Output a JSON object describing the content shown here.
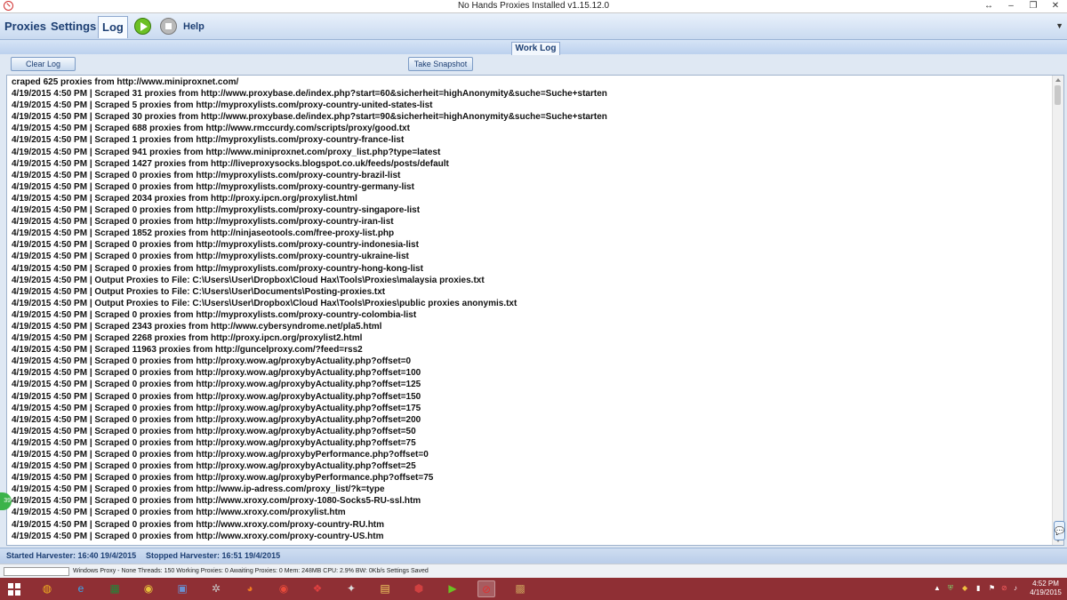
{
  "window": {
    "title": "No Hands Proxies Installed v1.15.12.0",
    "controls": {
      "pin": "↔",
      "minimize": "–",
      "maximize": "❐",
      "close": "✕"
    }
  },
  "menu": {
    "tabs": [
      "Proxies",
      "Settings",
      "Log"
    ],
    "active_tab": "Log",
    "help_label": "Help",
    "dropdown_glyph": "▼"
  },
  "panel": {
    "title": "Work Log"
  },
  "toolbar": {
    "clear_log_label": "Clear Log",
    "take_snapshot_label": "Take Snapshot"
  },
  "log": {
    "lines": [
      "craped 625 proxies from http://www.miniproxnet.com/",
      "4/19/2015 4:50 PM | Scraped 31 proxies from http://www.proxybase.de/index.php?start=60&sicherheit=highAnonymity&suche=Suche+starten",
      "4/19/2015 4:50 PM | Scraped 5 proxies from http://myproxylists.com/proxy-country-united-states-list",
      "4/19/2015 4:50 PM | Scraped 30 proxies from http://www.proxybase.de/index.php?start=90&sicherheit=highAnonymity&suche=Suche+starten",
      "4/19/2015 4:50 PM | Scraped 688 proxies from http://www.rmccurdy.com/scripts/proxy/good.txt",
      "4/19/2015 4:50 PM | Scraped 1 proxies from http://myproxylists.com/proxy-country-france-list",
      "4/19/2015 4:50 PM | Scraped 941 proxies from http://www.miniproxnet.com/proxy_list.php?type=latest",
      "4/19/2015 4:50 PM | Scraped 1427 proxies from http://liveproxysocks.blogspot.co.uk/feeds/posts/default",
      "4/19/2015 4:50 PM | Scraped 0 proxies from http://myproxylists.com/proxy-country-brazil-list",
      "4/19/2015 4:50 PM | Scraped 0 proxies from http://myproxylists.com/proxy-country-germany-list",
      "4/19/2015 4:50 PM | Scraped 2034 proxies from http://proxy.ipcn.org/proxylist.html",
      "4/19/2015 4:50 PM | Scraped 0 proxies from http://myproxylists.com/proxy-country-singapore-list",
      "4/19/2015 4:50 PM | Scraped 0 proxies from http://myproxylists.com/proxy-country-iran-list",
      "4/19/2015 4:50 PM | Scraped 1852 proxies from http://ninjaseotools.com/free-proxy-list.php",
      "4/19/2015 4:50 PM | Scraped 0 proxies from http://myproxylists.com/proxy-country-indonesia-list",
      "4/19/2015 4:50 PM | Scraped 0 proxies from http://myproxylists.com/proxy-country-ukraine-list",
      "4/19/2015 4:50 PM | Scraped 0 proxies from http://myproxylists.com/proxy-country-hong-kong-list",
      "4/19/2015 4:50 PM | Output Proxies to File: C:\\Users\\User\\Dropbox\\Cloud Hax\\Tools\\Proxies\\malaysia proxies.txt",
      "4/19/2015 4:50 PM | Output Proxies to File: C:\\Users\\User\\Documents\\Posting-proxies.txt",
      "4/19/2015 4:50 PM | Output Proxies to File: C:\\Users\\User\\Dropbox\\Cloud Hax\\Tools\\Proxies\\public proxies anonymis.txt",
      "4/19/2015 4:50 PM | Scraped 0 proxies from http://myproxylists.com/proxy-country-colombia-list",
      "4/19/2015 4:50 PM | Scraped 2343 proxies from http://www.cybersyndrome.net/pla5.html",
      "4/19/2015 4:50 PM | Scraped 2268 proxies from http://proxy.ipcn.org/proxylist2.html",
      "4/19/2015 4:50 PM | Scraped 11963 proxies from http://guncelproxy.com/?feed=rss2",
      "4/19/2015 4:50 PM | Scraped 0 proxies from http://proxy.wow.ag/proxybyActuality.php?offset=0",
      "4/19/2015 4:50 PM | Scraped 0 proxies from http://proxy.wow.ag/proxybyActuality.php?offset=100",
      "4/19/2015 4:50 PM | Scraped 0 proxies from http://proxy.wow.ag/proxybyActuality.php?offset=125",
      "4/19/2015 4:50 PM | Scraped 0 proxies from http://proxy.wow.ag/proxybyActuality.php?offset=150",
      "4/19/2015 4:50 PM | Scraped 0 proxies from http://proxy.wow.ag/proxybyActuality.php?offset=175",
      "4/19/2015 4:50 PM | Scraped 0 proxies from http://proxy.wow.ag/proxybyActuality.php?offset=200",
      "4/19/2015 4:50 PM | Scraped 0 proxies from http://proxy.wow.ag/proxybyActuality.php?offset=50",
      "4/19/2015 4:50 PM | Scraped 0 proxies from http://proxy.wow.ag/proxybyActuality.php?offset=75",
      "4/19/2015 4:50 PM | Scraped 0 proxies from http://proxy.wow.ag/proxybyPerformance.php?offset=0",
      "4/19/2015 4:50 PM | Scraped 0 proxies from http://proxy.wow.ag/proxybyActuality.php?offset=25",
      "4/19/2015 4:50 PM | Scraped 0 proxies from http://proxy.wow.ag/proxybyPerformance.php?offset=75",
      "4/19/2015 4:50 PM | Scraped 0 proxies from http://www.ip-adress.com/proxy_list/?k=type",
      "4/19/2015 4:50 PM | Scraped 0 proxies from http://www.xroxy.com/proxy-1080-Socks5-RU-ssl.htm",
      "4/19/2015 4:50 PM | Scraped 0 proxies from http://www.xroxy.com/proxylist.htm",
      "4/19/2015 4:50 PM | Scraped 0 proxies from http://www.xroxy.com/proxy-country-RU.htm",
      "4/19/2015 4:50 PM | Scraped 0 proxies from http://www.xroxy.com/proxy-country-US.htm"
    ]
  },
  "side_badges": {
    "left": "39",
    "right": "💬"
  },
  "harvester": {
    "started": "Started Harvester: 16:40 19/4/2015",
    "stopped": "Stopped Harvester: 16:51 19/4/2015"
  },
  "status": {
    "text": "Windows Proxy - None  Threads: 150  Working Proxies: 0  Awaiting Proxies: 0  Mem: 248MB  CPU: 2.9%  BW: 0Kb/s  Settings Saved"
  },
  "taskbar": {
    "apps": [
      {
        "icon": "chrome-canary-icon",
        "glyph": "◍",
        "color": "#f0b020"
      },
      {
        "icon": "internet-explorer-icon",
        "glyph": "e",
        "color": "#3aa8f0"
      },
      {
        "icon": "excel-icon",
        "glyph": "▦",
        "color": "#1f8a3a"
      },
      {
        "icon": "chrome-icon-1",
        "glyph": "◉",
        "color": "#e8c23a"
      },
      {
        "icon": "network-app-icon",
        "glyph": "▣",
        "color": "#6a8fd0"
      },
      {
        "icon": "settings-app-icon",
        "glyph": "✲",
        "color": "#c8c8c8"
      },
      {
        "icon": "firefox-icon",
        "glyph": "◕",
        "color": "#f07a20"
      },
      {
        "icon": "chrome-icon-2",
        "glyph": "◉",
        "color": "#e84a3a"
      },
      {
        "icon": "proxy-tool-icon",
        "glyph": "❖",
        "color": "#e04040"
      },
      {
        "icon": "bird-app-icon",
        "glyph": "✦",
        "color": "#dcdcdc"
      },
      {
        "icon": "file-explorer-icon",
        "glyph": "▤",
        "color": "#f2d060"
      },
      {
        "icon": "filezilla-icon",
        "glyph": "⬢",
        "color": "#d04040"
      },
      {
        "icon": "media-play-icon",
        "glyph": "▶",
        "color": "#6cc024"
      },
      {
        "icon": "no-hands-proxies-icon",
        "glyph": "⊘",
        "color": "#e03030"
      },
      {
        "icon": "package-icon",
        "glyph": "▩",
        "color": "#c89a5a"
      }
    ],
    "active_index": 13,
    "clock_time": "4:52 PM",
    "clock_date": "4/19/2015"
  }
}
